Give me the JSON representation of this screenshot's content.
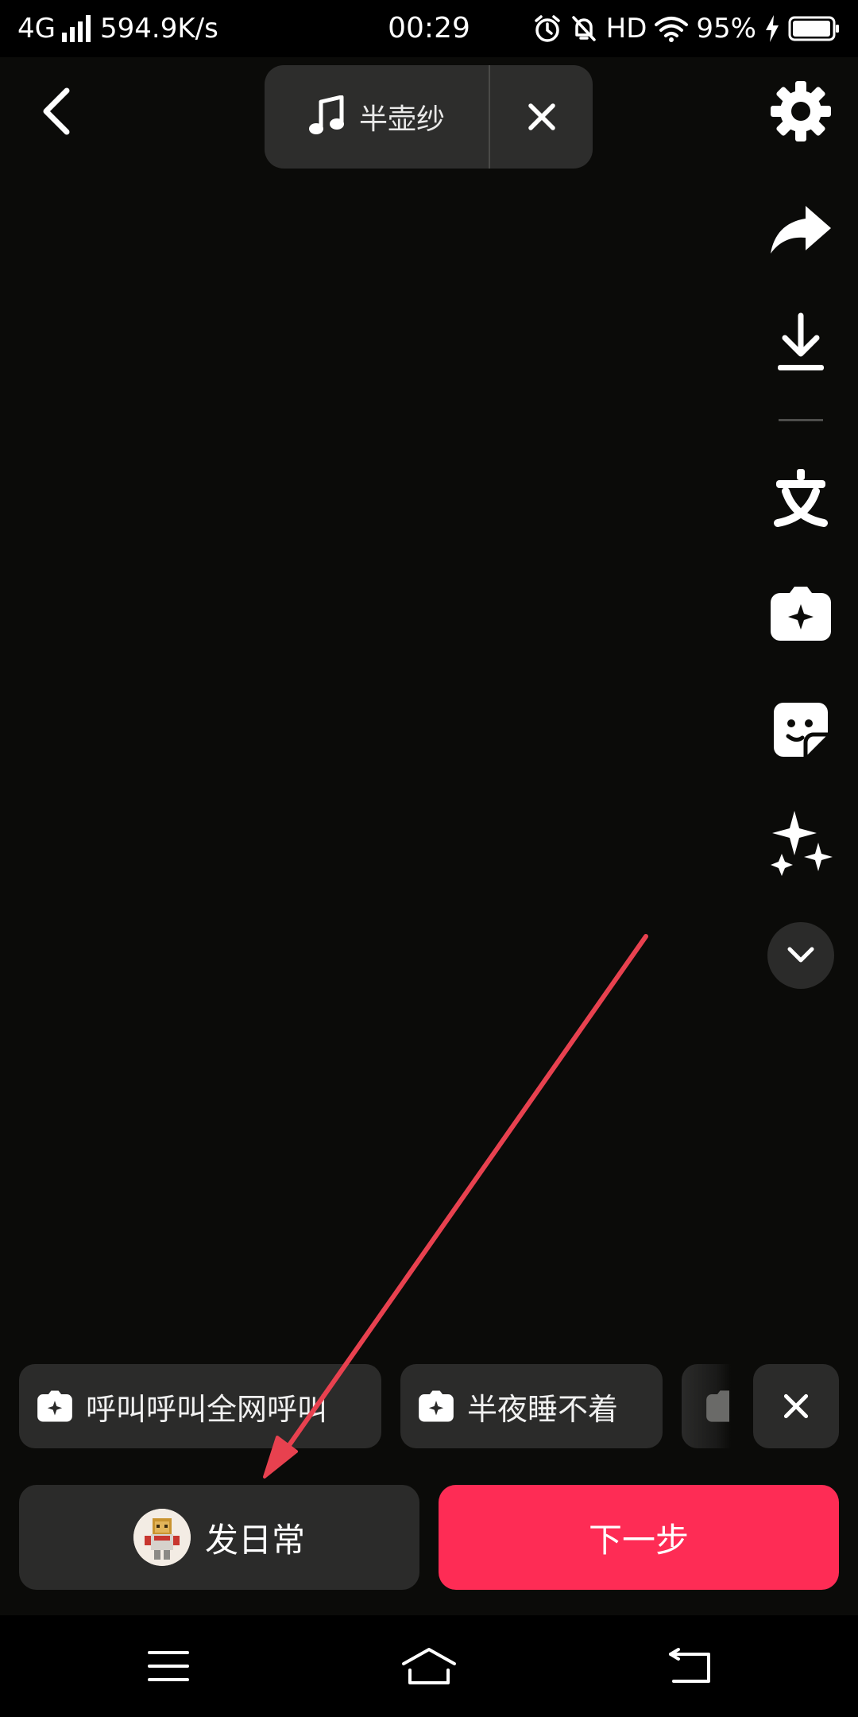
{
  "status_bar": {
    "network": "4G",
    "speed": "594.9K/s",
    "time": "00:29",
    "hd": "HD",
    "battery": "95%"
  },
  "music": {
    "title": "半壶纱",
    "icon": "music-note-icon",
    "close_icon": "close-icon"
  },
  "toolbar": {
    "icons": [
      "settings-icon",
      "share-icon",
      "download-icon",
      "text-icon",
      "sticker-icon",
      "sticker-note-icon",
      "effects-icon",
      "chevron-down-icon"
    ]
  },
  "chips": [
    {
      "label": "呼叫呼叫全网呼叫",
      "icon": "sticker-icon"
    },
    {
      "label": "半夜睡不着",
      "icon": "sticker-icon"
    }
  ],
  "actions": {
    "daily_label": "发日常",
    "next_label": "下一步"
  },
  "colors": {
    "background": "#0b0b09",
    "panel": "#2b2b2a",
    "accent": "#fe2c55",
    "annotation": "#e8414f"
  },
  "nav": {
    "icons": [
      "menu-icon",
      "home-icon",
      "back-icon"
    ]
  }
}
